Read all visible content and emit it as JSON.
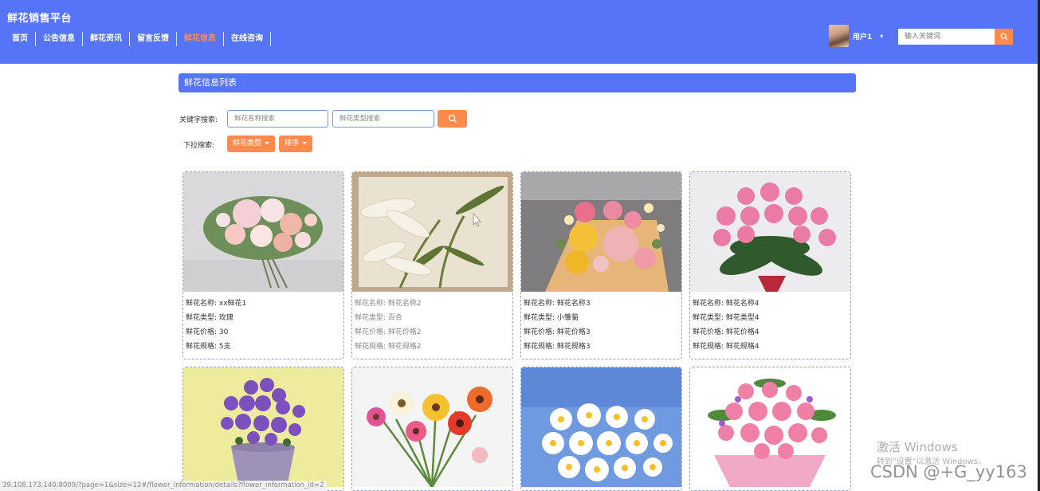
{
  "header": {
    "brand": "鲜花销售平台",
    "nav": [
      {
        "label": "首页",
        "active": false
      },
      {
        "label": "公告信息",
        "active": false
      },
      {
        "label": "鲜花资讯",
        "active": false
      },
      {
        "label": "留言反馈",
        "active": false
      },
      {
        "label": "鲜花信息",
        "active": true
      },
      {
        "label": "在线咨询",
        "active": false
      }
    ],
    "user_name": "用户1",
    "user_caret": "▾",
    "search_placeholder": "输入关键词",
    "search_icon": "search-icon"
  },
  "main": {
    "title": "鲜花信息列表",
    "keyword_label": "关键字搜索:",
    "name_placeholder": "鲜花名称搜索",
    "type_placeholder": "鲜花类型搜索",
    "dropdown_label": "下拉搜索:",
    "type_dropdown": "鲜花类型",
    "sort_dropdown": "排序"
  },
  "cards": [
    {
      "name": "鲜花名称: xx鲜花1",
      "type": "鲜花类型: 玫瑰",
      "price": "鲜花价格: 30",
      "spec": "鲜花规格: 5支",
      "image": "mixed-bouquet"
    },
    {
      "name": "鲜花名称: 鲜花名称2",
      "type": "鲜花类型: 百合",
      "price": "鲜花价格: 鲜花价格2",
      "spec": "鲜花规格: 鲜花规格2",
      "image": "white-lilies"
    },
    {
      "name": "鲜花名称: 鲜花名称3",
      "type": "鲜花类型: 小雏菊",
      "price": "鲜花价格: 鲜花价格3",
      "spec": "鲜花规格: 鲜花规格3",
      "image": "yellow-pink-rose-bouquet"
    },
    {
      "name": "鲜花名称: 鲜花名称4",
      "type": "鲜花类型: 鲜花类型4",
      "price": "鲜花价格: 鲜花价格4",
      "spec": "鲜花规格: 鲜花规格4",
      "image": "pink-roses"
    },
    {
      "image": "purple-potted-flowers"
    },
    {
      "image": "gerbera-daisies"
    },
    {
      "image": "white-daisies"
    },
    {
      "image": "pink-gerbera-bouquet"
    }
  ],
  "overlay": {
    "status_url": "39.108.173.140:8009/?page=1&size=12#/flower_information/details?flower_information_id=2",
    "win_title": "激活 Windows",
    "win_sub": "转到\"设置\"以激活 Windows。",
    "csdn": "CSDN @+G_yy163"
  },
  "colors": {
    "primary": "#5674f8",
    "accent": "#ff8a4b"
  }
}
